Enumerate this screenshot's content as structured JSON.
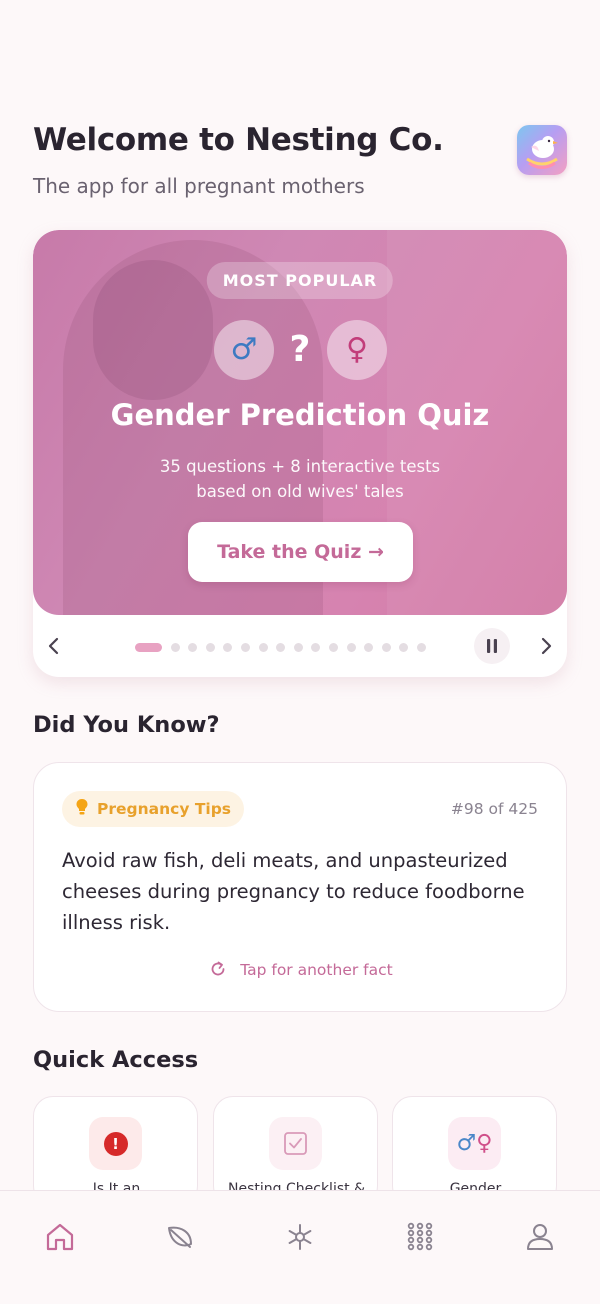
{
  "header": {
    "title": "Welcome to Nesting Co.",
    "subtitle": "The app for all pregnant mothers",
    "logo_icon": "bird-logo-icon"
  },
  "hero": {
    "badge": "MOST POPULAR",
    "male_symbol": "♂",
    "question_mark": "?",
    "female_symbol": "♀",
    "title": "Gender Prediction Quiz",
    "description_line1": "35 questions + 8 interactive tests",
    "description_line2": "based on old wives' tales",
    "cta_label": "Take the Quiz →",
    "carousel": {
      "total_slides": 16,
      "active_slide": 1,
      "prev_icon": "chevron-left-icon",
      "next_icon": "chevron-right-icon",
      "pause_icon": "pause-icon"
    }
  },
  "did_you_know": {
    "section_title": "Did You Know?",
    "category": "Pregnancy Tips",
    "category_icon": "lightbulb-icon",
    "counter": "#98 of 425",
    "fact": "Avoid raw fish, deli meats, and unpasteurized cheeses during pregnancy to reduce foodborne illness risk.",
    "refresh_label": "Tap for another fact"
  },
  "quick_access": {
    "section_title": "Quick Access",
    "items": [
      {
        "label": "Is It an",
        "icon": "alert-icon"
      },
      {
        "label": "Nesting Checklist &",
        "icon": "checkbox-icon"
      },
      {
        "label": "Gender",
        "icon": "gender-symbols-icon"
      }
    ]
  },
  "bottom_nav": {
    "tabs": [
      {
        "name": "home",
        "icon": "home-icon",
        "active": true
      },
      {
        "name": "leaf",
        "icon": "leaf-icon",
        "active": false
      },
      {
        "name": "tools",
        "icon": "asterisk-icon",
        "active": false
      },
      {
        "name": "apps",
        "icon": "grid-icon",
        "active": false
      },
      {
        "name": "profile",
        "icon": "user-icon",
        "active": false
      }
    ]
  },
  "colors": {
    "accent": "#c46a98",
    "hero_gradient_start": "#c77aa9",
    "tip_chip_bg": "#fdf3e3",
    "tip_text": "#e8a12c",
    "active_dot": "#e8a2c2"
  }
}
